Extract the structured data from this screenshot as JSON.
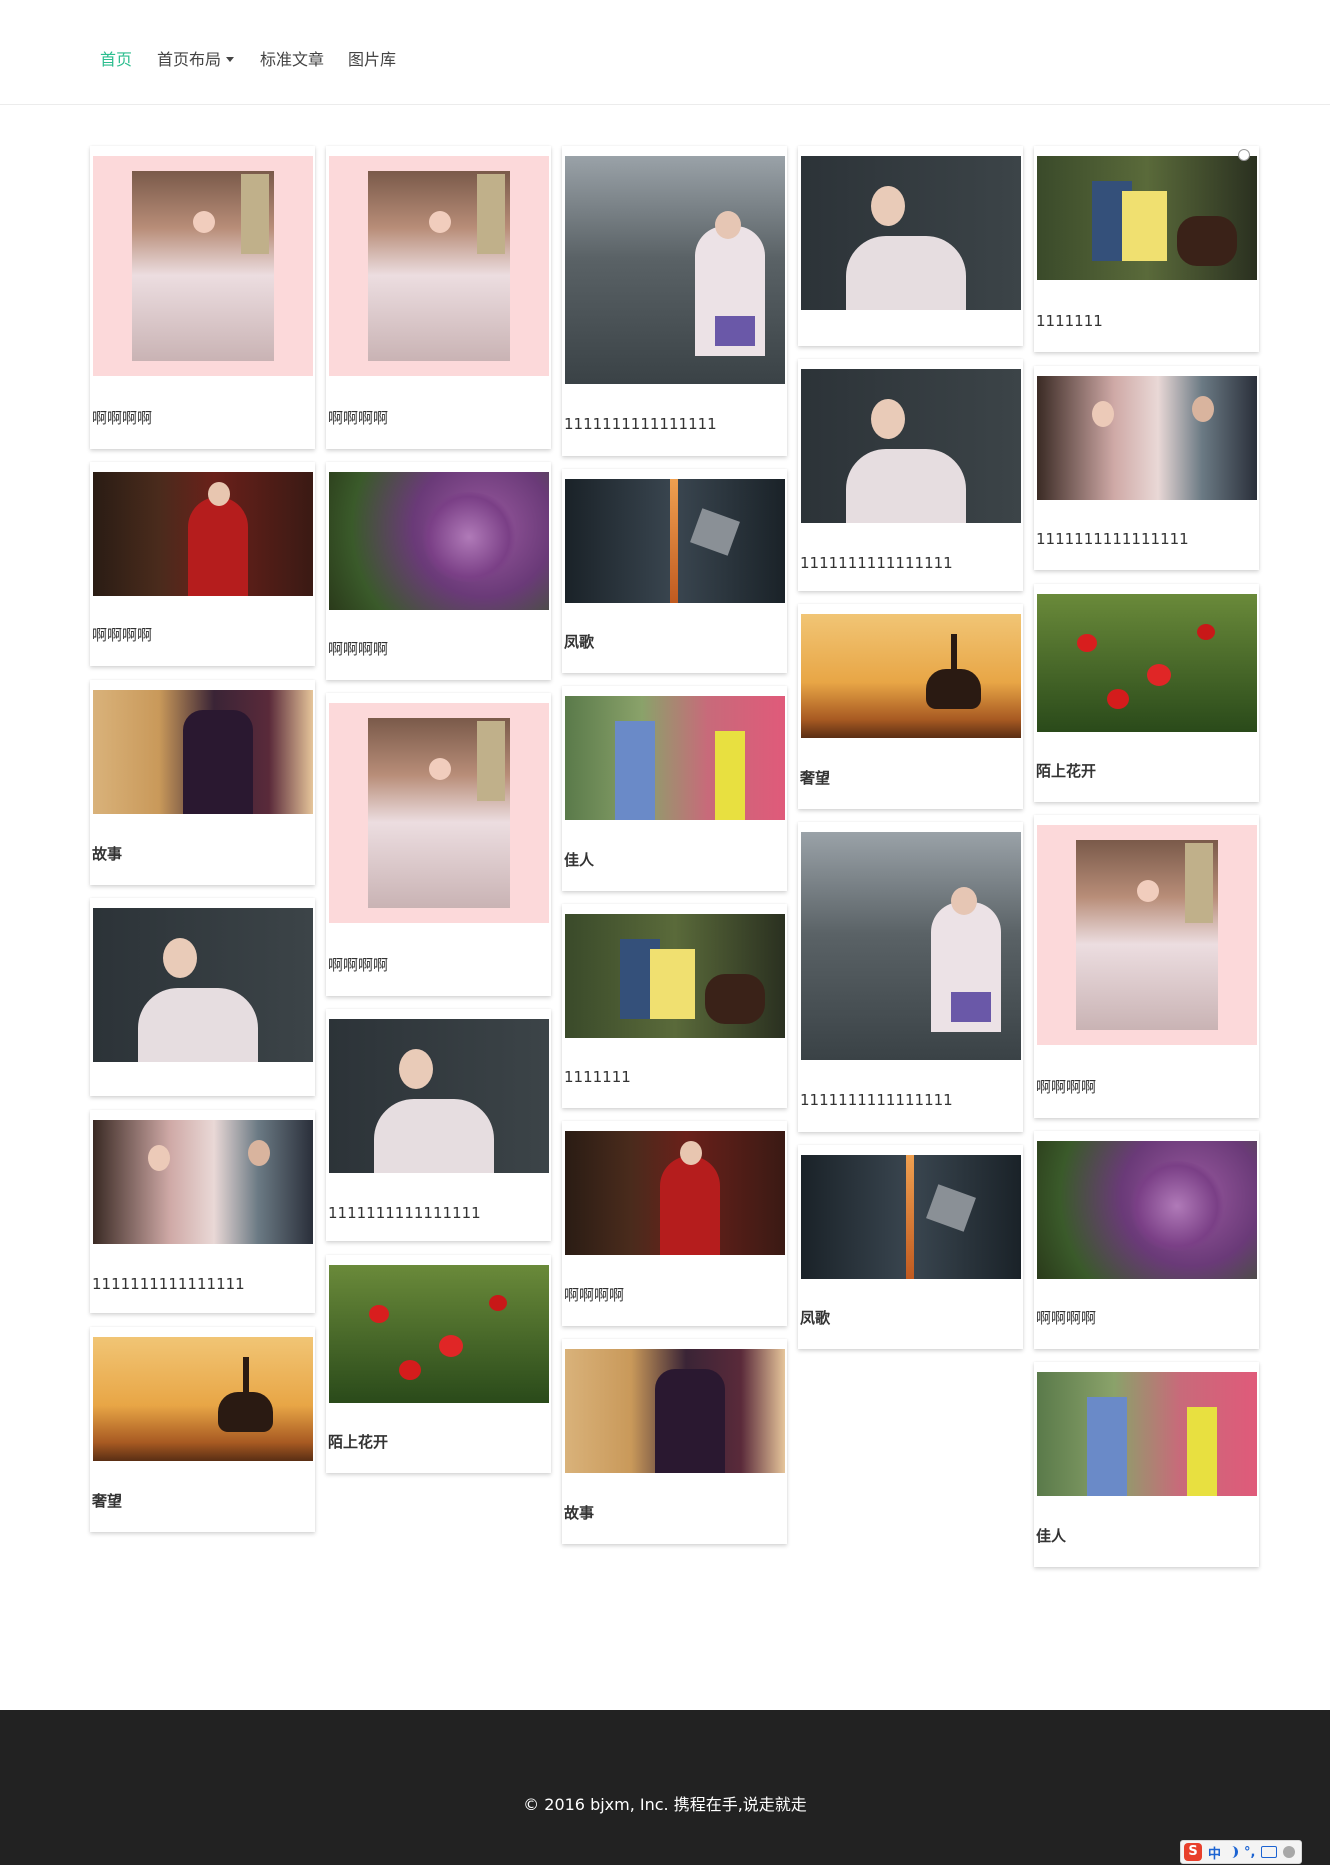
{
  "nav": {
    "items": [
      "首页",
      "首页布局",
      "标准文章",
      "图片库"
    ],
    "active_color": "#2bbd8e"
  },
  "cards": [
    {
      "caption": "啊啊啊啊",
      "image": "girl-kimono-pink-frame"
    },
    {
      "caption": "啊啊啊啊",
      "image": "red-dress-woman"
    },
    {
      "caption": "故事",
      "image": "drama-poster-man"
    },
    {
      "caption": "",
      "image": "girl-kimono-dark"
    },
    {
      "caption": "1111111111111111",
      "image": "couple-drama"
    },
    {
      "caption": "奢望",
      "image": "deer-sunset"
    },
    {
      "caption": "啊啊啊啊",
      "image": "girl-kimono-pink-frame"
    },
    {
      "caption": "啊啊啊啊",
      "image": "lilac-flowers"
    },
    {
      "caption": "啊啊啊啊",
      "image": "girl-kimono-pink-frame"
    },
    {
      "caption": "1111111111111111",
      "image": "girl-kimono-dark"
    },
    {
      "caption": "陌上花开",
      "image": "red-poppies"
    },
    {
      "caption": "1111111111111111",
      "image": "street-kimono-girl"
    },
    {
      "caption": "凤歌",
      "image": "thor-hammer"
    },
    {
      "caption": "佳人",
      "image": "garden-drama-scene"
    },
    {
      "caption": "1111111",
      "image": "riding-couple"
    },
    {
      "caption": "啊啊啊啊",
      "image": "red-dress-woman"
    },
    {
      "caption": "故事",
      "image": "drama-poster-man"
    },
    {
      "caption": "",
      "image": "girl-kimono-dark"
    },
    {
      "caption": "1111111111111111",
      "image": "girl-kimono-dark"
    },
    {
      "caption": "奢望",
      "image": "deer-sunset"
    },
    {
      "caption": "1111111111111111",
      "image": "street-kimono-girl"
    },
    {
      "caption": "凤歌",
      "image": "thor-hammer"
    },
    {
      "caption": "1111111",
      "image": "riding-couple"
    },
    {
      "caption": "1111111111111111",
      "image": "couple-drama"
    },
    {
      "caption": "陌上花开",
      "image": "red-poppies"
    },
    {
      "caption": "啊啊啊啊",
      "image": "girl-kimono-pink-frame"
    },
    {
      "caption": "啊啊啊啊",
      "image": "lilac-flowers"
    },
    {
      "caption": "佳人",
      "image": "garden-drama-scene"
    }
  ],
  "footer": {
    "copyright": "© 2016 bjxm, Inc. 携程在手,说走就走",
    "background": "#222222"
  },
  "ime": {
    "logo": "S",
    "mode": "中",
    "punct": "°,"
  }
}
